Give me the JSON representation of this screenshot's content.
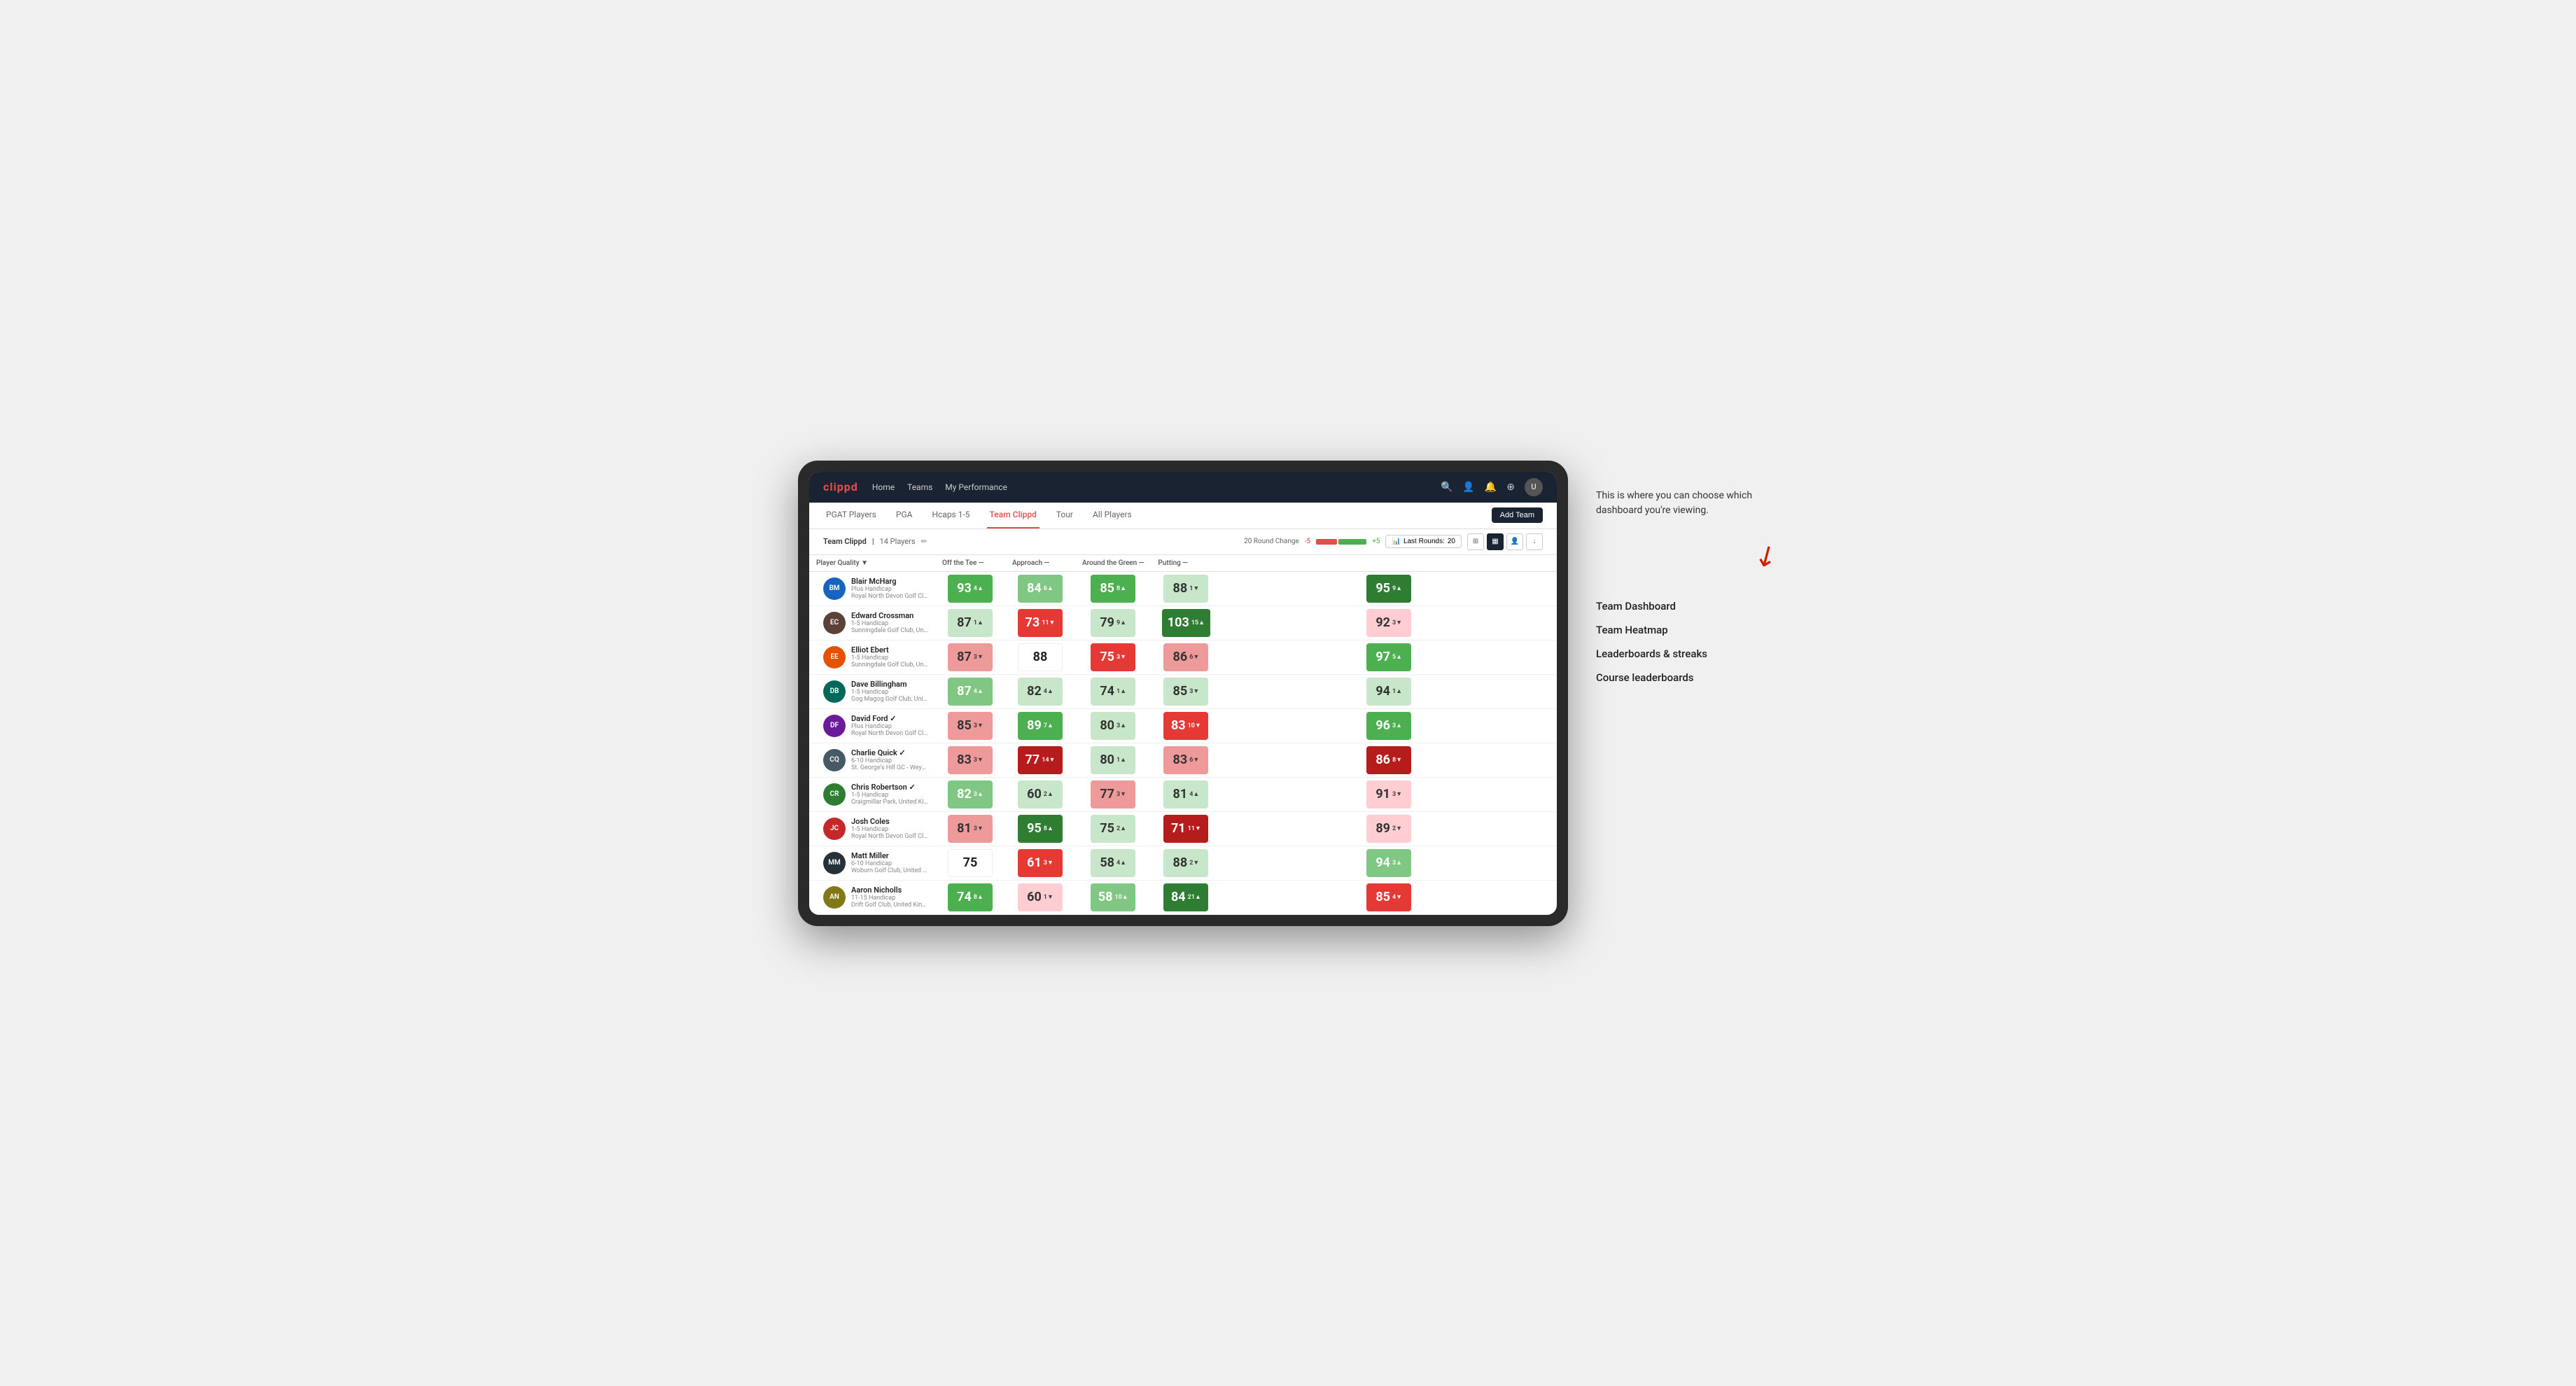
{
  "annotation": {
    "intro": "This is where you can choose which dashboard you're viewing.",
    "items": [
      "Team Dashboard",
      "Team Heatmap",
      "Leaderboards & streaks",
      "Course leaderboards"
    ]
  },
  "navbar": {
    "logo": "clippd",
    "links": [
      "Home",
      "Teams",
      "My Performance"
    ],
    "icons": [
      "🔍",
      "👤",
      "🔔",
      "⊕"
    ]
  },
  "sub_nav": {
    "tabs": [
      "PGAT Players",
      "PGA",
      "Hcaps 1-5",
      "Team Clippd",
      "Tour",
      "All Players"
    ],
    "active": "Team Clippd",
    "add_team_label": "Add Team"
  },
  "team_header": {
    "name": "Team Clippd",
    "separator": "|",
    "count": "14 Players",
    "round_change_label": "20 Round Change",
    "neg": "-5",
    "pos": "+5",
    "last_rounds_label": "Last Rounds:",
    "last_rounds_count": "20"
  },
  "table": {
    "columns": {
      "player": "Player Quality ▼",
      "off_tee": "Off the Tee —",
      "approach": "Approach —",
      "around_green": "Around the Green —",
      "putting": "Putting —"
    },
    "rows": [
      {
        "name": "Blair McHarg",
        "handicap": "Plus Handicap",
        "club": "Royal North Devon Golf Club, United Kingdom",
        "initials": "BM",
        "av_class": "av-blue",
        "player_quality": {
          "value": 93,
          "change": "4",
          "dir": "up",
          "color": "bg-green"
        },
        "off_tee": {
          "value": 84,
          "change": "6",
          "dir": "up",
          "color": "bg-light-green"
        },
        "approach": {
          "value": 85,
          "change": "8",
          "dir": "up",
          "color": "bg-green"
        },
        "around_green": {
          "value": 88,
          "change": "1",
          "dir": "down",
          "color": "bg-pale-green"
        },
        "putting": {
          "value": 95,
          "change": "9",
          "dir": "up",
          "color": "bg-dark-green"
        }
      },
      {
        "name": "Edward Crossman",
        "handicap": "1-5 Handicap",
        "club": "Sunningdale Golf Club, United Kingdom",
        "initials": "EC",
        "av_class": "av-brown",
        "player_quality": {
          "value": 87,
          "change": "1",
          "dir": "up",
          "color": "bg-pale-green"
        },
        "off_tee": {
          "value": 73,
          "change": "11",
          "dir": "down",
          "color": "bg-red"
        },
        "approach": {
          "value": 79,
          "change": "9",
          "dir": "up",
          "color": "bg-pale-green"
        },
        "around_green": {
          "value": 103,
          "change": "15",
          "dir": "up",
          "color": "bg-dark-green"
        },
        "putting": {
          "value": 92,
          "change": "3",
          "dir": "down",
          "color": "bg-pale-red"
        }
      },
      {
        "name": "Elliot Ebert",
        "handicap": "1-5 Handicap",
        "club": "Sunningdale Golf Club, United Kingdom",
        "initials": "EE",
        "av_class": "av-orange",
        "player_quality": {
          "value": 87,
          "change": "3",
          "dir": "down",
          "color": "bg-light-red"
        },
        "off_tee": {
          "value": 88,
          "change": "",
          "dir": "",
          "color": "bg-white"
        },
        "approach": {
          "value": 75,
          "change": "3",
          "dir": "down",
          "color": "bg-red"
        },
        "around_green": {
          "value": 86,
          "change": "6",
          "dir": "down",
          "color": "bg-light-red"
        },
        "putting": {
          "value": 97,
          "change": "5",
          "dir": "up",
          "color": "bg-green"
        }
      },
      {
        "name": "Dave Billingham",
        "handicap": "1-5 Handicap",
        "club": "Gog Magog Golf Club, United Kingdom",
        "initials": "DB",
        "av_class": "av-teal",
        "player_quality": {
          "value": 87,
          "change": "4",
          "dir": "up",
          "color": "bg-light-green"
        },
        "off_tee": {
          "value": 82,
          "change": "4",
          "dir": "up",
          "color": "bg-pale-green"
        },
        "approach": {
          "value": 74,
          "change": "1",
          "dir": "up",
          "color": "bg-pale-green"
        },
        "around_green": {
          "value": 85,
          "change": "3",
          "dir": "down",
          "color": "bg-pale-green"
        },
        "putting": {
          "value": 94,
          "change": "1",
          "dir": "up",
          "color": "bg-pale-green"
        }
      },
      {
        "name": "David Ford ✓",
        "handicap": "Plus Handicap",
        "club": "Royal North Devon Golf Club, United Kingdom",
        "initials": "DF",
        "av_class": "av-purple",
        "player_quality": {
          "value": 85,
          "change": "3",
          "dir": "down",
          "color": "bg-light-red"
        },
        "off_tee": {
          "value": 89,
          "change": "7",
          "dir": "up",
          "color": "bg-green"
        },
        "approach": {
          "value": 80,
          "change": "3",
          "dir": "up",
          "color": "bg-pale-green"
        },
        "around_green": {
          "value": 83,
          "change": "10",
          "dir": "down",
          "color": "bg-red"
        },
        "putting": {
          "value": 96,
          "change": "3",
          "dir": "up",
          "color": "bg-green"
        }
      },
      {
        "name": "Charlie Quick ✓",
        "handicap": "6-10 Handicap",
        "club": "St. George's Hill GC - Weybridge - Surrey, Uni...",
        "initials": "CQ",
        "av_class": "av-grey",
        "player_quality": {
          "value": 83,
          "change": "3",
          "dir": "down",
          "color": "bg-light-red"
        },
        "off_tee": {
          "value": 77,
          "change": "14",
          "dir": "down",
          "color": "bg-dark-red"
        },
        "approach": {
          "value": 80,
          "change": "1",
          "dir": "up",
          "color": "bg-pale-green"
        },
        "around_green": {
          "value": 83,
          "change": "6",
          "dir": "down",
          "color": "bg-light-red"
        },
        "putting": {
          "value": 86,
          "change": "8",
          "dir": "down",
          "color": "bg-dark-red"
        }
      },
      {
        "name": "Chris Robertson ✓",
        "handicap": "1-5 Handicap",
        "club": "Craigmillar Park, United Kingdom",
        "initials": "CR",
        "av_class": "av-green",
        "player_quality": {
          "value": 82,
          "change": "3",
          "dir": "up",
          "color": "bg-light-green"
        },
        "off_tee": {
          "value": 60,
          "change": "2",
          "dir": "up",
          "color": "bg-pale-green"
        },
        "approach": {
          "value": 77,
          "change": "3",
          "dir": "down",
          "color": "bg-light-red"
        },
        "around_green": {
          "value": 81,
          "change": "4",
          "dir": "up",
          "color": "bg-pale-green"
        },
        "putting": {
          "value": 91,
          "change": "3",
          "dir": "down",
          "color": "bg-pale-red"
        }
      },
      {
        "name": "Josh Coles",
        "handicap": "1-5 Handicap",
        "club": "Royal North Devon Golf Club, United Kingdom",
        "initials": "JC",
        "av_class": "av-red",
        "player_quality": {
          "value": 81,
          "change": "3",
          "dir": "down",
          "color": "bg-light-red"
        },
        "off_tee": {
          "value": 95,
          "change": "8",
          "dir": "up",
          "color": "bg-dark-green"
        },
        "approach": {
          "value": 75,
          "change": "2",
          "dir": "up",
          "color": "bg-pale-green"
        },
        "around_green": {
          "value": 71,
          "change": "11",
          "dir": "down",
          "color": "bg-dark-red"
        },
        "putting": {
          "value": 89,
          "change": "2",
          "dir": "down",
          "color": "bg-pale-red"
        }
      },
      {
        "name": "Matt Miller",
        "handicap": "6-10 Handicap",
        "club": "Woburn Golf Club, United Kingdom",
        "initials": "MM",
        "av_class": "av-dark",
        "player_quality": {
          "value": 75,
          "change": "",
          "dir": "",
          "color": "bg-white"
        },
        "off_tee": {
          "value": 61,
          "change": "3",
          "dir": "down",
          "color": "bg-red"
        },
        "approach": {
          "value": 58,
          "change": "4",
          "dir": "up",
          "color": "bg-pale-green"
        },
        "around_green": {
          "value": 88,
          "change": "2",
          "dir": "down",
          "color": "bg-pale-green"
        },
        "putting": {
          "value": 94,
          "change": "3",
          "dir": "up",
          "color": "bg-light-green"
        }
      },
      {
        "name": "Aaron Nicholls",
        "handicap": "11-15 Handicap",
        "club": "Drift Golf Club, United Kingdom",
        "initials": "AN",
        "av_class": "av-olive",
        "player_quality": {
          "value": 74,
          "change": "8",
          "dir": "up",
          "color": "bg-green"
        },
        "off_tee": {
          "value": 60,
          "change": "1",
          "dir": "down",
          "color": "bg-pale-red"
        },
        "approach": {
          "value": 58,
          "change": "10",
          "dir": "up",
          "color": "bg-light-green"
        },
        "around_green": {
          "value": 84,
          "change": "21",
          "dir": "up",
          "color": "bg-dark-green"
        },
        "putting": {
          "value": 85,
          "change": "4",
          "dir": "down",
          "color": "bg-red"
        }
      }
    ]
  }
}
